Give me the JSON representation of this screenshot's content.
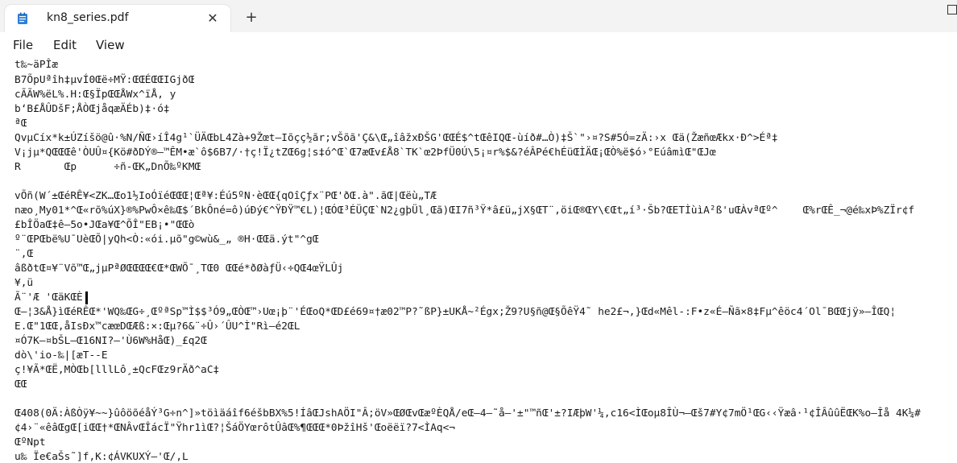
{
  "window": {
    "tab_title": "kn8_series.pdf",
    "close_glyph": "✕",
    "new_tab_glyph": "+",
    "file_icon": "notepad-icon"
  },
  "menu": {
    "file": "File",
    "edit": "Edit",
    "view": "View"
  },
  "content": {
    "lines": [
      "t‰~äPÎæ",
      "B7ÕpUªîh‡µvÍ0Œë÷MŸ:ŒŒÉŒŒIGjðŒ",
      "cÃÃW%ëL%.H:Œ§ÏpŒŒÅWx^ïÅ, y",
      "b‘B£ÅÛDšF;ÅÒŒjåqæÄÉb)‡·ó‡",
      "ªŒ",
      "QvµCíx*k±ÚZíšö@û·%N/ÑŒ›íÎ4g¹`ÜÄŒbL4Zà+9Žœt–Iõçç½ãr;vŠõã'Ç&\\Œ„îâžxÐŠG'ŒŒÉ$^tŒêIQŒ-ùíð#…Ò)‡Š`\"›¤?S#5Ó=zÄ:›x Œä(ŽæñœÆkx·Ð^>Éª‡",
      "V¡jµ*QŒŒŒê'ÒUÛ¤{Kö#ðDÝ®–™ÊM•æ`ô$6B7/·†ç!Ï¿tZŒ6g¦s‡ó^Œ`Œ7æŒv£Å8`TK`œ2ÞfÜ0Ú\\5¡¤r%$&?éÂPé€hÉüŒÌÄŒ¡ŒÒ%ë$ó›°EúâmìŒ\"ŒJœ",
      "R       Œp      ÷ñ-ŒK„DnÕ‰ºKMŒ",
      "",
      "vÕñ(W´±ŒéRÊ¥<ZK…Œo1½IoÓïéŒŒŒ¦Œª¥:Éú5ºN·èŒŒ{qOîÇƒx¨PŒ'ðŒ.à\".ãŒ|Œëù„TÆ",
      "næo¸My01*^Œ«rõ%úX}®%PwÔ×ê‰Œ$´BkÔné=ô)úÐý€^ŸÐŸ™€L)¦ŒÓŒ³ÉÜÇŒ`N2¿gþÜl¸Œã)ŒI7ñ³Ÿ*â£ü„jX§ŒT¨,öiŒ®ŒY\\€Œt„í³·Šb?ŒETÌùìA²ß'uŒÀvªŒº^    Œ%rŒÊ_¬@é‰xÞ%ZÏr¢f",
      "£bÎÖaŒ‡ê–5o•JŒa¥Œ^ÕÎ\"EB¡•\"ŒŒò",
      "º¨ŒPŒbë%U¯UèŒÕ|yQh<Ò:«ói.µõ\"g©wù&_„ ®H·ŒŒä.ýt\"^gŒ",
      "¨,Œ",
      "âßðtŒ¤¥¨Võ™Œ„jµPªØŒŒŒŒ€Œ*ŒWÕ¯¸TŒ0 ŒŒé*ðØàƒÜ‹÷QŒ4œŸLÛj",
      "¥,ü",
      "Ã¨'Æ 'ŒäKŒÈ",
      "Œ–¦3&Å}ìŒéRÊŒ*'WQ‰ŒG÷¸ŒºªSp™Ì$$³Ó9„ŒÒŒ™›Uœ¡þ¨'ÉŒoQ*ŒD£é69¤†æ02™P?˜ßP}±UKÅ~²Égx;Ž9?U§ñ@Œ§ÕêŸ4˜ he2£¬,}Œd«Mêl-:F•z«É–Ñã×8‡Fµ^êöc4´Ol¯BŒŒjÿ»–ÎŒQ¦",
      "E.Œ\"1ŒŒ,åIsÐx™cæœDŒÆß:×:Œµ?6&¨÷Û›´ÛU^Ì\"Rì–é2ŒL",
      "¤Ó7K–¤bŠL–Œ16NI?–'Ù6W%HåŒ)_£q2Œ",
      "dò\\'io-‰|[æT--E",
      "ç!¥Ã*ŒË,MÒŒb[lllLô¸±QcFŒz9rÄð^aC‡",
      "ŒŒ",
      "",
      "Œ408(0Ä:ÀßÒÿ¥~~}ûôöõéåÝ³G÷n^]»töìäáîf6éšbBX%5!ÍâŒJshAÖI\"Â;öV»ŒØŒvŒæºÈQÅ/eŒ–4–˜å–'±\"™ñŒ'±?IÆþW'¼,c16<ÌŒoµ8ÎÙ¬–Œš7#Y¢7mÖ¹ŒG‹‹Ÿæâ·¹¢ÎÂûûËŒK%o–Îå 4K¼#",
      "¢4›¨«êâŒgŒ[iŒŒ†*ŒNÂvŒÎácÏ\"Ÿhr1ìŒ?¦ŠáÖYœrôtÛâŒ%¶ŒŒŒ*0ÞžîHš'Œoëëï?7<ÌAq<¬",
      "ŒºNpt",
      "u‰ Ïe€aŠs˜]f,K:¢ÁVKUXÝ–'Œ/,L"
    ]
  }
}
